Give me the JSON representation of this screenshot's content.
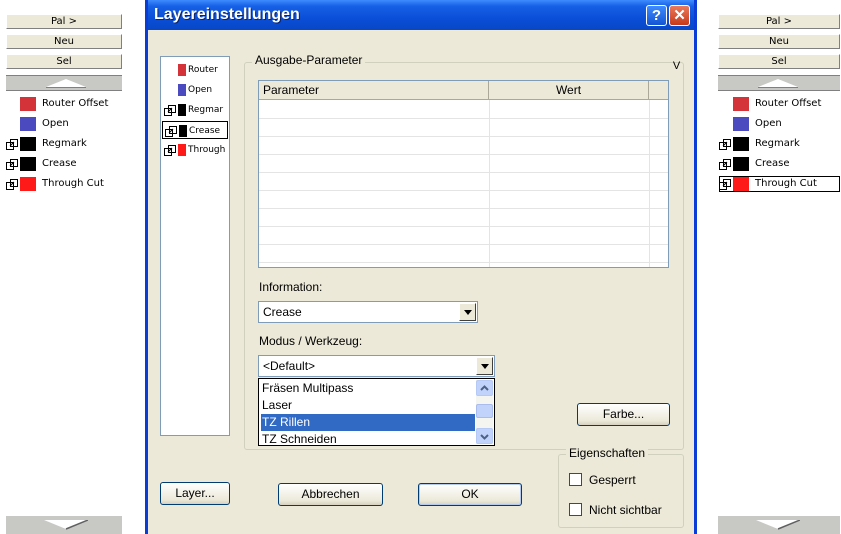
{
  "left_palette": {
    "buttons": [
      "Pal >",
      "Neu",
      "Sel"
    ],
    "layers": [
      {
        "name": "Router Offset",
        "color": "#d4333a",
        "linked": false
      },
      {
        "name": "Open",
        "color": "#4b4bbf",
        "linked": false
      },
      {
        "name": "Regmark",
        "color": "#000000",
        "linked": true
      },
      {
        "name": "Crease",
        "color": "#000000",
        "linked": true
      },
      {
        "name": "Through Cut",
        "color": "#ff1a1a",
        "linked": true
      }
    ]
  },
  "right_palette": {
    "buttons": [
      "Pal >",
      "Neu",
      "Sel"
    ],
    "layers": [
      {
        "name": "Router Offset",
        "color": "#d4333a",
        "linked": false
      },
      {
        "name": "Open",
        "color": "#4b4bbf",
        "linked": false
      },
      {
        "name": "Regmark",
        "color": "#000000",
        "linked": true
      },
      {
        "name": "Crease",
        "color": "#000000",
        "linked": true
      },
      {
        "name": "Through Cut",
        "color": "#ff1a1a",
        "linked": true
      }
    ],
    "selected_index": 4
  },
  "dialog": {
    "title": "Layereinstellungen",
    "help_glyph": "?",
    "close_glyph": "✕",
    "layer_list": [
      {
        "name": "Router",
        "color": "#d4333a",
        "linked": false
      },
      {
        "name": "Open",
        "color": "#4b4bbf",
        "linked": false
      },
      {
        "name": "Regmar",
        "color": "#000000",
        "linked": true
      },
      {
        "name": "Crease",
        "color": "#000000",
        "linked": true
      },
      {
        "name": "Through",
        "color": "#ff1a1a",
        "linked": true
      }
    ],
    "selected_layer_index": 3,
    "output_group_title": "Ausgabe-Parameter",
    "v_button": "V",
    "table_headers": [
      "Parameter",
      "Wert"
    ],
    "information_label": "Information:",
    "information_value": "Crease",
    "mode_label": "Modus / Werkzeug:",
    "mode_value": "<Default>",
    "mode_options": [
      "Fräsen Multipass",
      "Laser",
      "TZ Rillen",
      "TZ Schneiden"
    ],
    "mode_highlighted_index": 2,
    "farbe_button": "Farbe...",
    "properties_title": "Eigenschaften",
    "checkbox_locked": "Gesperrt",
    "checkbox_hidden": "Nicht sichtbar",
    "layer_button": "Layer...",
    "cancel_button": "Abbrechen",
    "ok_button": "OK"
  }
}
